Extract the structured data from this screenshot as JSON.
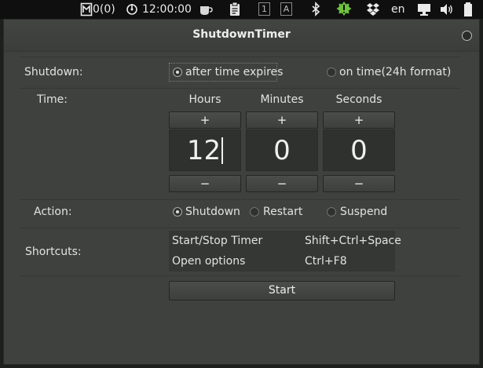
{
  "top_panel": {
    "mail_count": "0(0)",
    "clock": "12:00:00",
    "workspace_1": "1",
    "workspace_2": "A",
    "keyboard_layout": "en"
  },
  "window": {
    "title": "ShutdownTimer"
  },
  "shutdown_row": {
    "label": "Shutdown:",
    "option_after": "after time expires",
    "option_on_time": "on time(24h format)",
    "selected": "after time expires"
  },
  "time_row": {
    "label": "Time:",
    "hours_label": "Hours",
    "minutes_label": "Minutes",
    "seconds_label": "Seconds",
    "hours_value": "12",
    "minutes_value": "0",
    "seconds_value": "0",
    "plus": "+",
    "minus": "−"
  },
  "action_row": {
    "label": "Action:",
    "options": [
      "Shutdown",
      "Restart",
      "Suspend"
    ],
    "selected": "Shutdown"
  },
  "shortcuts_row": {
    "label": "Shortcuts:",
    "rows": [
      {
        "name": "Start/Stop Timer",
        "keys": "Shift+Ctrl+Space"
      },
      {
        "name": "Open options",
        "keys": "Ctrl+F8"
      }
    ]
  },
  "start_button": {
    "label": "Start"
  },
  "colors": {
    "panel_bg": "#0f0f0f",
    "window_bg": "#3f413f",
    "tray_green": "#6fc23c"
  },
  "icons": [
    "mail-icon",
    "power-icon",
    "coffee-icon",
    "clipboard-icon",
    "bluetooth-icon",
    "update-badge-icon",
    "dropbox-icon",
    "display-icon",
    "volume-icon",
    "battery-icon"
  ]
}
